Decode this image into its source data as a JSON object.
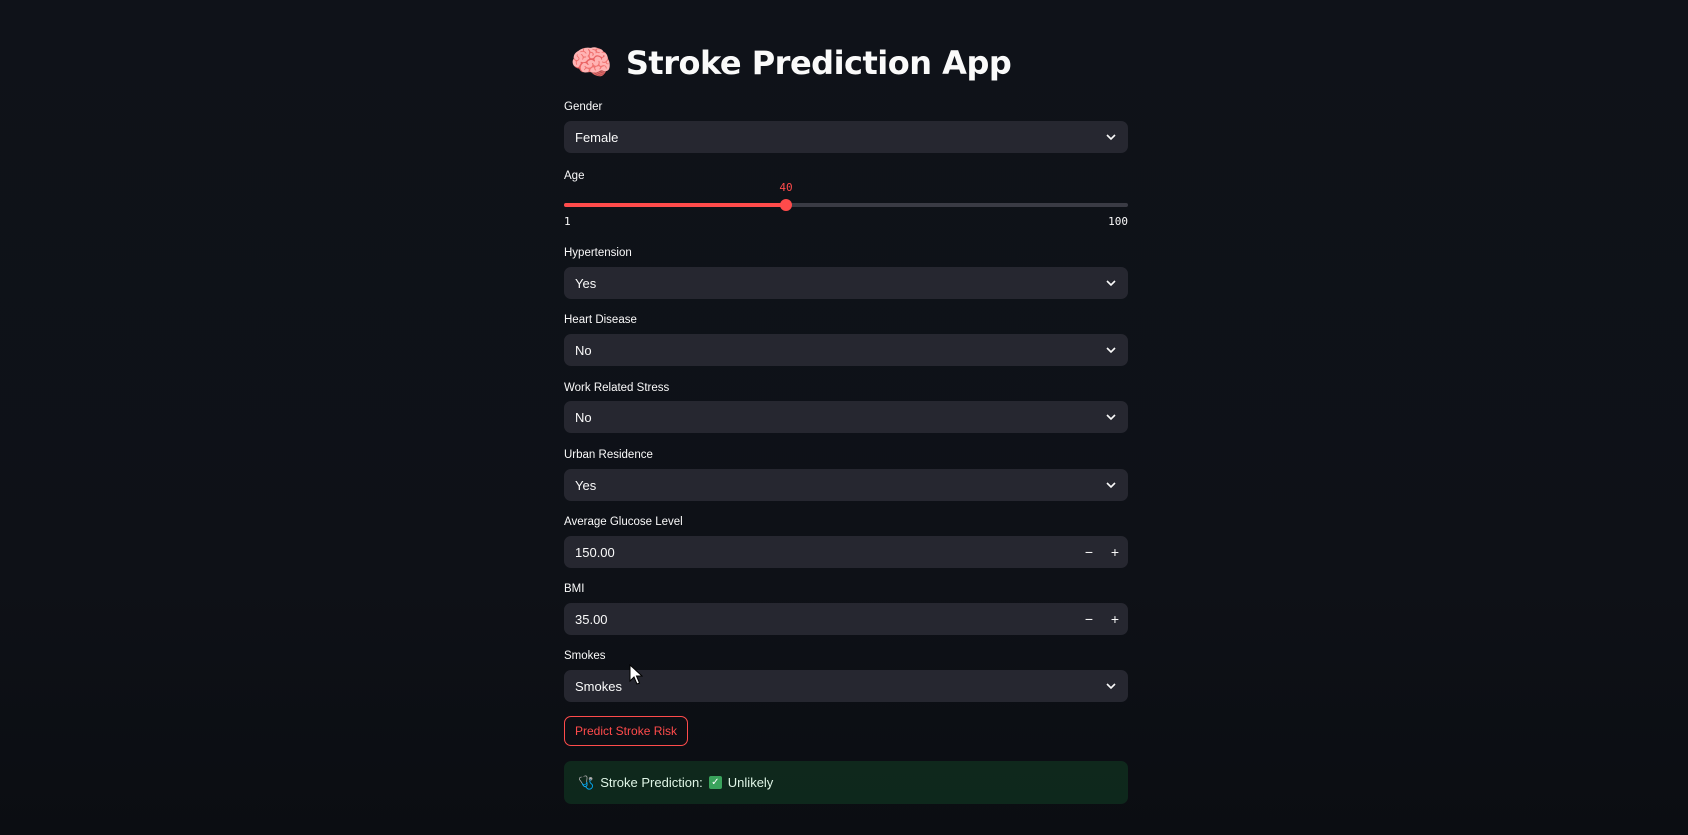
{
  "app": {
    "title": "Stroke Prediction App",
    "title_icon": "brain-emoji"
  },
  "fields": {
    "gender": {
      "label": "Gender",
      "value": "Female"
    },
    "age": {
      "label": "Age",
      "value": "40",
      "min": "1",
      "max": "100",
      "fraction": 0.394
    },
    "hypertension": {
      "label": "Hypertension",
      "value": "Yes"
    },
    "heart_disease": {
      "label": "Heart Disease",
      "value": "No"
    },
    "work_stress": {
      "label": "Work Related Stress",
      "value": "No"
    },
    "urban_residence": {
      "label": "Urban Residence",
      "value": "Yes"
    },
    "glucose": {
      "label": "Average Glucose Level",
      "value": "150.00",
      "minus": "−",
      "plus": "+"
    },
    "bmi": {
      "label": "BMI",
      "value": "35.00",
      "minus": "−",
      "plus": "+"
    },
    "smokes": {
      "label": "Smokes",
      "value": "Smokes"
    }
  },
  "predict_button": {
    "label": "Predict Stroke Risk"
  },
  "result": {
    "icon": "stethoscope-icon",
    "prefix": "Stroke Prediction:",
    "status_icon": "check-box-icon",
    "value": "Unlikely"
  },
  "colors": {
    "background": "#0e1117",
    "widget": "#262730",
    "accent": "#ff4b4b",
    "success_bg": "#173928"
  }
}
